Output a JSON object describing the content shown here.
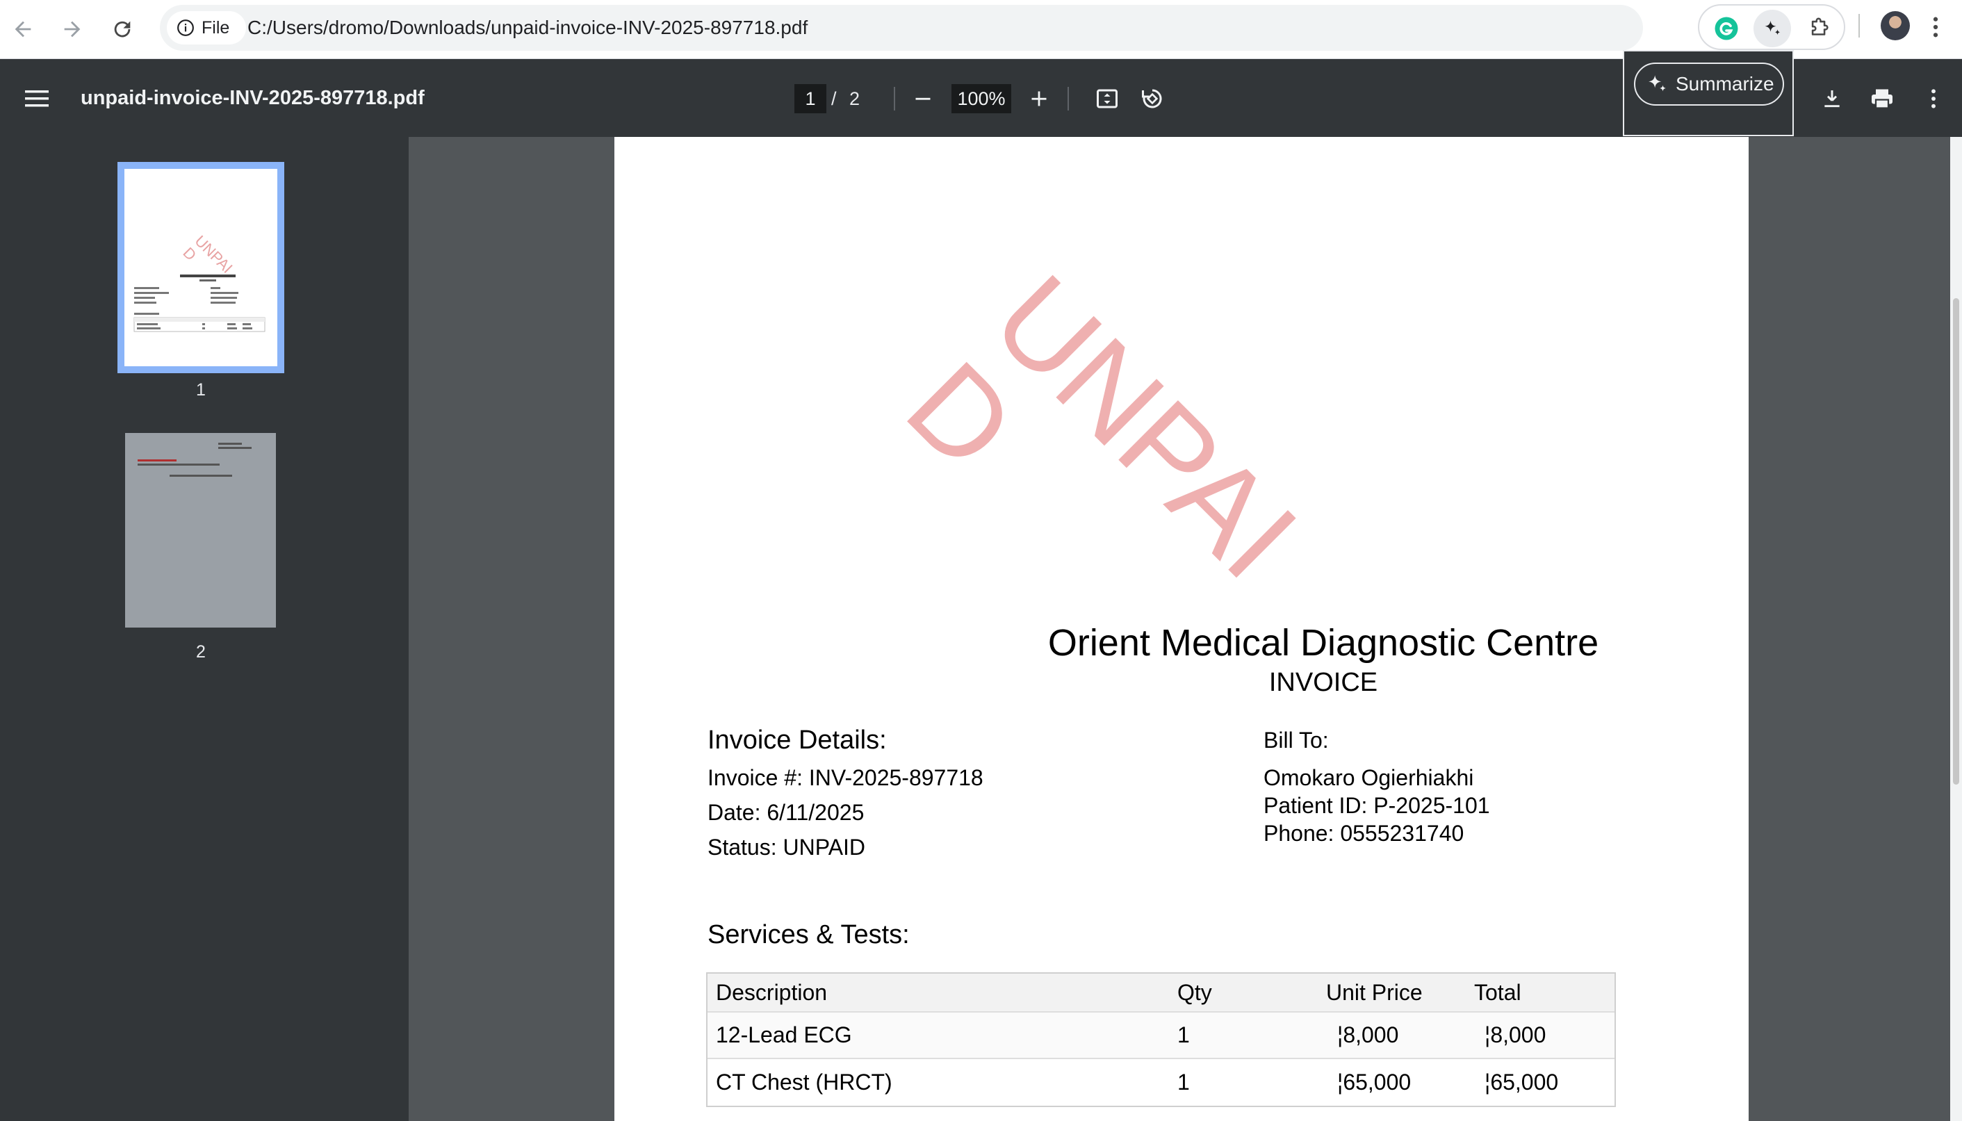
{
  "browser": {
    "site_chip_label": "File",
    "url": "C:/Users/dromo/Downloads/unpaid-invoice-INV-2025-897718.pdf"
  },
  "pdf_toolbar": {
    "filename": "unpaid-invoice-INV-2025-897718.pdf",
    "current_page": "1",
    "page_separator": "/",
    "total_pages": "2",
    "zoom": "100%",
    "summarize_label": "Summarize"
  },
  "sidebar": {
    "thumbnails": [
      {
        "label": "1"
      },
      {
        "label": "2"
      }
    ]
  },
  "invoice": {
    "watermark_line1": "UNPAI",
    "watermark_line2": "D",
    "clinic_name": "Orient Medical Diagnostic Centre",
    "doc_type": "INVOICE",
    "details_heading": "Invoice Details:",
    "invoice_number": "Invoice #: INV-2025-897718",
    "date": "Date: 6/11/2025",
    "status": "Status: UNPAID",
    "bill_to_heading": "Bill To:",
    "patient_name": "Omokaro Ogierhiakhi",
    "patient_id": "Patient ID: P-2025-101",
    "phone": "Phone: 0555231740",
    "services_heading": "Services & Tests:",
    "table": {
      "headers": [
        "Description",
        "Qty",
        "Unit Price",
        "Total"
      ],
      "rows": [
        [
          "12-Lead ECG",
          "1",
          "¦8,000",
          "¦8,000"
        ],
        [
          "CT Chest (HRCT)",
          "1",
          "¦65,000",
          "¦65,000"
        ]
      ]
    }
  },
  "colors": {
    "toolbar_bg": "#323639",
    "viewer_bg": "#525659",
    "thumbnail_highlight": "#8ab4f8",
    "watermark": "#e8a3a3"
  }
}
